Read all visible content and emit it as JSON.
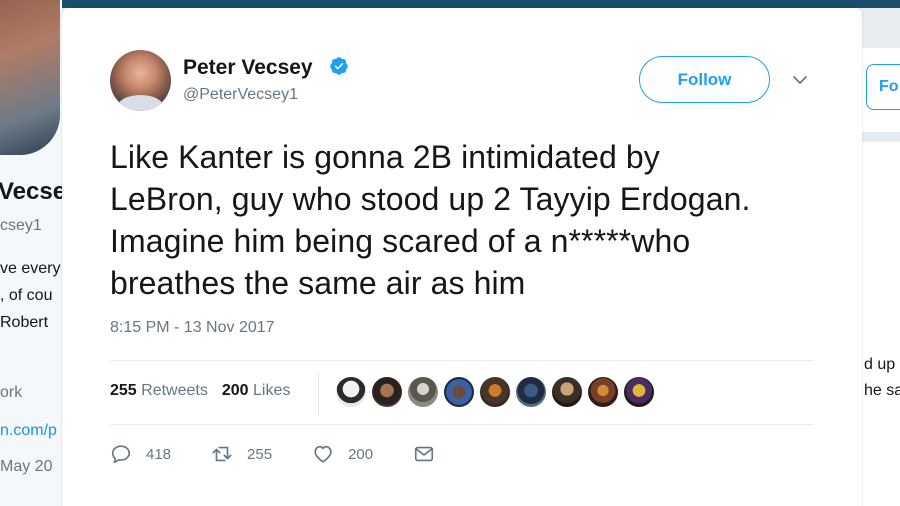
{
  "background": {
    "profile_name": "Vecse",
    "profile_handle": "csey1",
    "bio_line1": "ve every",
    "bio_line2": ", of cou",
    "bio_line3": " Robert",
    "location": "ork",
    "url": "n.com/p",
    "joined": " May 20",
    "right_follow_label": "Fo",
    "right_text1": "d up",
    "right_text2": "he sa"
  },
  "tweet": {
    "display_name": "Peter Vecsey",
    "handle": "@PeterVecsey1",
    "follow_label": "Follow",
    "text_lines": [
      "Like Kanter is gonna 2B intimidated by",
      "LeBron, guy who stood up 2 Tayyip Erdogan.",
      "Imagine him being scared of a n*****who",
      "breathes the same air as him"
    ],
    "timestamp": "8:15 PM - 13 Nov 2017",
    "retweets_count": "255",
    "retweets_label": "Retweets",
    "likes_count": "200",
    "likes_label": "Likes",
    "actions": {
      "reply_count": "418",
      "retweet_count": "255",
      "like_count": "200"
    }
  },
  "icons": {
    "verified": "verified-badge-icon",
    "caret": "chevron-down-icon",
    "reply": "reply-icon",
    "retweet": "retweet-icon",
    "like": "heart-icon",
    "dm": "envelope-icon"
  },
  "colors": {
    "accent": "#1da1f2",
    "text": "#14171a",
    "muted": "#657786",
    "divider": "#e6ecf0"
  }
}
